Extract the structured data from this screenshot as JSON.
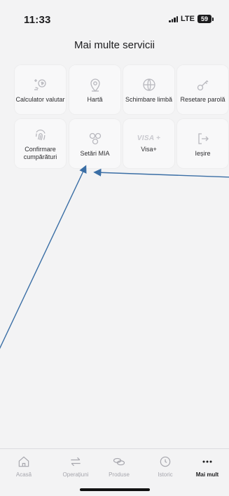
{
  "status_bar": {
    "time": "11:33",
    "network": "LTE",
    "battery": "59"
  },
  "header": {
    "title": "Mai multe servicii"
  },
  "services": [
    {
      "label": "Calculator valutar",
      "icon": "currency-calculator-icon"
    },
    {
      "label": "Hartă",
      "icon": "map-pin-icon"
    },
    {
      "label": "Schimbare limbă",
      "icon": "globe-icon"
    },
    {
      "label": "Resetare parolă",
      "icon": "key-icon"
    },
    {
      "label": "Confirmare cumpărături",
      "icon": "fingerprint-icon"
    },
    {
      "label": "Setări MIA",
      "icon": "mia-circles-icon"
    },
    {
      "label": "Visa+",
      "icon": "visa-icon",
      "mark": "VISA +"
    },
    {
      "label": "Ieșire",
      "icon": "logout-icon"
    }
  ],
  "tab_bar": {
    "items": [
      {
        "label": "Acasă",
        "icon": "home-icon"
      },
      {
        "label": "Operațiuni",
        "icon": "transfer-arrows-icon"
      },
      {
        "label": "Produse",
        "icon": "coins-icon"
      },
      {
        "label": "Istoric",
        "icon": "clock-icon"
      },
      {
        "label": "Mai mult",
        "icon": "more-dots-icon",
        "active": true
      }
    ]
  },
  "colors": {
    "background": "#f3f3f4",
    "tile": "#f8f8f9",
    "icon": "#b8b8be",
    "annotation_arrow": "#3a6ea5"
  }
}
